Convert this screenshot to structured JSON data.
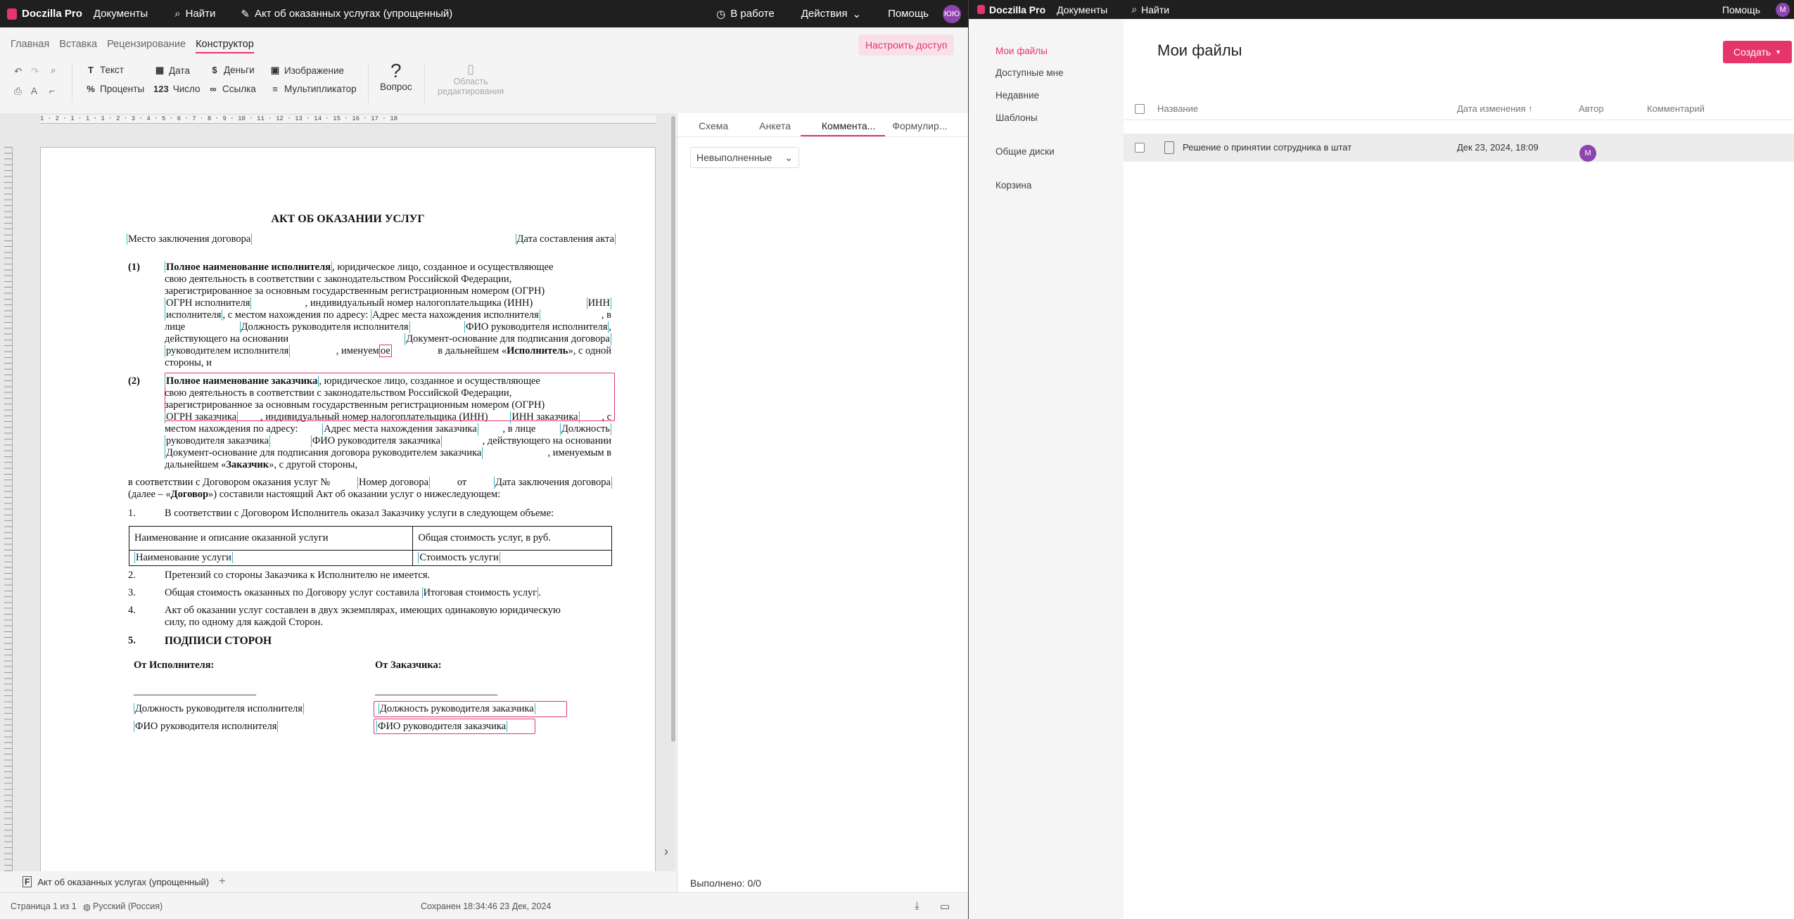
{
  "left_top": {
    "brand": "Doczilla Pro",
    "documents": "Документы",
    "search": "Найти",
    "doc_name": "Акт об оказанных услугах (упрощенный)",
    "status": "В работе",
    "actions": "Действия",
    "help": "Помощь",
    "avatar": "ЮЮ"
  },
  "tabs": [
    "Главная",
    "Вставка",
    "Рецензирование",
    "Конструктор"
  ],
  "setup_access": "Настроить доступ",
  "ribbon": {
    "text": "Текст",
    "date": "Дата",
    "money": "Деньги",
    "image": "Изображение",
    "percent": "Проценты",
    "number_icon": "123",
    "number": "Число",
    "link": "Ссылка",
    "multiplier": "Мультипликатор",
    "question": "Вопрос",
    "edit_area_1": "Область",
    "edit_area_2": "редактирования"
  },
  "ruler_text": "1 ⋅ 2 ⋅ 1 ⋅ 1 ⋅ 1 ⋅ 2 ⋅ 3 ⋅ 4 ⋅ 5 ⋅ 6 ⋅ 7 ⋅ 8 ⋅ 9 ⋅ 10 ⋅ 11 ⋅ 12 ⋅ 13 ⋅ 14 ⋅ 15 ⋅ 16 ⋅ 17 ⋅ 18",
  "doc": {
    "title": "АКТ ОБ ОКАЗАНИИ УСЛУГ",
    "place": "Место заключения договора",
    "act_date": "Дата составления акта",
    "n1": "(1)",
    "p1": [
      [
        "Полное наименование исполнителя",
        ", юридическое лицо, созданное и осуществляющее"
      ],
      [
        "свою деятельность в соответствии с законодательством Российской Федерации,",
        ""
      ],
      [
        "зарегистрированное за основным государственным регистрационным номером (ОГРН)",
        ""
      ],
      [
        "ОГРН исполнителя",
        ", индивидуальный номер налогоплательщика (ИНН)",
        "ИНН"
      ],
      [
        "исполнителя",
        ", с местом нахождения по адресу:",
        "Адрес места нахождения исполнителя",
        ", в"
      ],
      [
        "лице",
        "Должность руководителя исполнителя",
        "ФИО руководителя исполнителя",
        ","
      ],
      [
        "действующего на основании",
        "Документ-основание для подписания договора"
      ],
      [
        "руководителем исполнителя",
        ", именуем",
        "ое",
        " в дальнейшем «",
        "Исполнитель",
        "», с одной"
      ],
      [
        "стороны, и"
      ]
    ],
    "n2": "(2)",
    "p2": [
      [
        "Полное наименование заказчика",
        ", юридическое лицо, созданное и осуществляющее"
      ],
      [
        "свою деятельность в соответствии с законодательством Российской Федерации,"
      ],
      [
        "зарегистрированное за основным государственным регистрационным номером (ОГРН)"
      ],
      [
        "ОГРН заказчика",
        ", индивидуальный номер налогоплательщика (ИНН)",
        "ИНН заказчика",
        ", с"
      ],
      [
        "местом нахождения по адресу:",
        "Адрес места нахождения заказчика",
        ", в лице",
        "Должность"
      ],
      [
        "руководителя заказчика",
        "ФИО руководителя заказчика",
        ", действующего на основании"
      ],
      [
        "Документ-основание для подписания договора руководителем заказчика",
        ", именуемым в"
      ],
      [
        "дальнейшем «",
        "Заказчик",
        "», с другой стороны,"
      ]
    ],
    "contract_line1": [
      "в соответствии с Договором оказания услуг №",
      "Номер договора",
      "от",
      "Дата заключения договора"
    ],
    "contract_line2": [
      "(далее – «",
      "Договор",
      "») составили настоящий Акт об оказании услуг о нижеследующем:"
    ],
    "i1_num": "1.",
    "i1": "В соответствии с Договором Исполнитель оказал Заказчику услуги в следующем объеме:",
    "th1": "Наименование и описание оказанной услуги",
    "th2": "Общая стоимость услуг, в руб.",
    "td1": "Наименование услуги",
    "td2": "Стоимость услуги",
    "i2_num": "2.",
    "i2": "Претензий со стороны Заказчика к Исполнителю не имеется.",
    "i3_num": "3.",
    "i3": "Общая стоимость оказанных по Договору услуг составила",
    "i3_field": "Итоговая стоимость услуг",
    "i3_end": ".",
    "i4_num": "4.",
    "i4a": "Акт об оказании услуг составлен в двух экземплярах, имеющих одинаковую юридическую",
    "i4b": "силу, по одному для каждой Сторон.",
    "i5_num": "5.",
    "i5": "ПОДПИСИ СТОРОН",
    "from_exec": "От Исполнителя:",
    "from_cust": "От Заказчика:",
    "line": "________________________",
    "exec_pos": "Должность руководителя исполнителя",
    "exec_fio": "ФИО руководителя исполнителя",
    "cust_pos": "Должность руководителя заказчика",
    "cust_fio": "ФИО руководителя заказчика"
  },
  "right_tabs": [
    "Схема",
    "Анкета",
    "Коммента...",
    "Формулир..."
  ],
  "filter": "Невыполненные",
  "done": "Выполнено: 0/0",
  "bottom_doc": "Акт об оказанных услугах (упрощенный)",
  "add_tab": "+",
  "status": {
    "page": "Страница 1 из 1",
    "lang": "Русский (Россия)",
    "saved": "Сохранен 18:34:46 23 Дек, 2024"
  },
  "r_top": {
    "brand": "Doczilla Pro",
    "documents": "Документы",
    "search": "Найти",
    "help": "Помощь",
    "avatar": "М"
  },
  "r_nav": [
    "Мои файлы",
    "Доступные мне",
    "Недавние",
    "Шаблоны",
    "Общие диски",
    "Корзина"
  ],
  "r_title": "Мои файлы",
  "create": "Создать",
  "r_cols": [
    "Название",
    "Дата изменения ↑",
    "Автор",
    "Комментарий"
  ],
  "r_row": {
    "name": "Решение о принятии сотрудника в штат",
    "date": "Дек 23, 2024, 18:09",
    "author": "М"
  },
  "colors": {
    "accent": "#e5356b",
    "field": "#3ab3c6",
    "dark": "#1f1f1f"
  },
  "icons": [
    "logo-icon",
    "search-icon",
    "pen-icon",
    "clock-icon",
    "chevron-down-icon",
    "undo-icon",
    "redo-icon",
    "zoom-icon",
    "print-icon",
    "spell-icon",
    "format-painter-icon",
    "text-icon",
    "calendar-icon",
    "dollar-icon",
    "image-icon",
    "percent-icon",
    "link-icon",
    "multiplier-icon",
    "question-icon",
    "edit-area-icon",
    "expand-icon",
    "word-icon",
    "globe-icon",
    "download-icon",
    "panel-icon"
  ]
}
